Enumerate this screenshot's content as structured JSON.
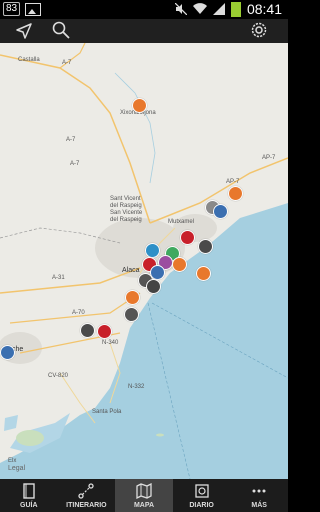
{
  "status": {
    "left_badge": "83",
    "time": "08:41"
  },
  "topbar": {
    "icons": [
      "navigate-arrow-icon",
      "search-icon",
      "settings-gear-icon"
    ]
  },
  "map": {
    "labels": {
      "castalla": "Castalla",
      "a7_1": "A-7",
      "a7_2": "A-7",
      "a7_3": "A-7",
      "ap7_1": "AP-7",
      "ap7_2": "AP-7",
      "a31": "A-31",
      "a70": "A-70",
      "cv820": "CV-820",
      "n332": "N-332",
      "n340": "N-340",
      "xixona": "Xixona/Jijona",
      "sant_vicent_1": "Sant Vicent",
      "sant_vicent_2": "del Raspeig",
      "sant_vicent_3": "San Vicente",
      "sant_vicent_4": "del Raspeig",
      "mutxamel": "Mutxamel",
      "alicante": "Alaca",
      "elche": "che",
      "santa_pola": "Santa Pola",
      "elx_small": "Elx",
      "legal": "Legal"
    }
  },
  "tabs": [
    {
      "label": "GUÍA",
      "icon": "book-icon"
    },
    {
      "label": "ITINERARIO",
      "icon": "route-icon"
    },
    {
      "label": "MAPA",
      "icon": "map-icon"
    },
    {
      "label": "DIARIO",
      "icon": "camera-diary-icon"
    },
    {
      "label": "MÁS",
      "icon": "more-dots-icon"
    }
  ]
}
